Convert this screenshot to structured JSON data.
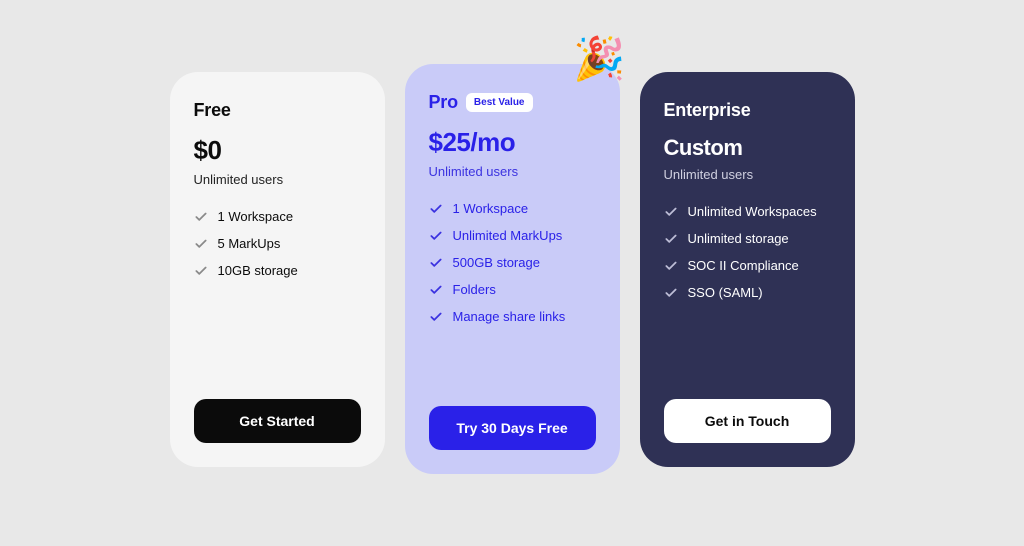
{
  "plans": {
    "free": {
      "title": "Free",
      "price": "$0",
      "subtext": "Unlimited users",
      "features": [
        "1 Workspace",
        "5 MarkUps",
        "10GB storage"
      ],
      "cta": "Get Started"
    },
    "pro": {
      "title": "Pro",
      "badge": "Best Value",
      "price": "$25/mo",
      "subtext": "Unlimited users",
      "features": [
        "1 Workspace",
        "Unlimited MarkUps",
        "500GB storage",
        "Folders",
        "Manage share links"
      ],
      "cta": "Try 30 Days Free",
      "party_emoji": "🎉"
    },
    "enterprise": {
      "title": "Enterprise",
      "price": "Custom",
      "subtext": "Unlimited users",
      "features": [
        "Unlimited Workspaces",
        "Unlimited storage",
        "SOC II Compliance",
        "SSO (SAML)"
      ],
      "cta": "Get in Touch"
    }
  }
}
